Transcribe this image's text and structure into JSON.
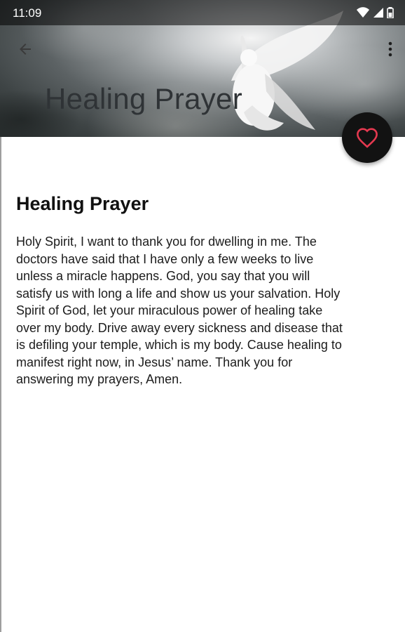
{
  "status_bar": {
    "time": "11:09",
    "icons": [
      "wifi-icon",
      "signal-icon",
      "battery-icon"
    ]
  },
  "toolbar": {
    "title": "Healing Prayer",
    "back_icon": "arrow-back-icon",
    "menu_icon": "more-vert-icon"
  },
  "fab": {
    "icon": "heart-outline-icon",
    "accent_color": "#e53950"
  },
  "prayer": {
    "heading": "Healing Prayer",
    "text": "Holy Spirit, I want to thank you for dwelling in me.  The\ndoctors have said that I have only a few weeks to live\nunless a miracle happens.  God, you say that you will\nsatisfy us with long a life and show us your salvation.  Holy\nSpirit of God, let your miraculous power of healing take\nover my body.  Drive away every sickness and disease that\nis defiling your temple, which is my body. Cause healing to\nmanifest right now, in Jesus’ name. Thank you for\nanswering my prayers, Amen."
  }
}
